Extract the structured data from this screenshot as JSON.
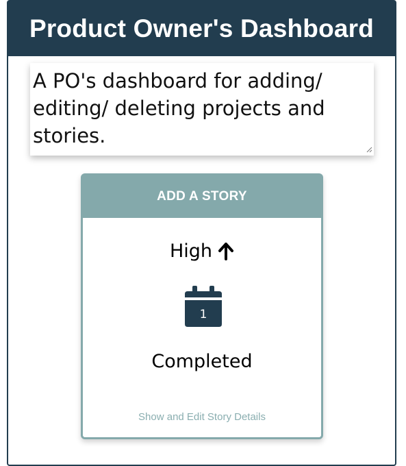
{
  "header": {
    "title": "Product Owner's Dashboard"
  },
  "description": {
    "value": "A PO's dashboard for adding/ editing/ deleting projects and stories."
  },
  "story_card": {
    "header_label": "ADD A STORY",
    "priority": "High",
    "priority_icon": "arrow-up-icon",
    "calendar_icon": "calendar-icon",
    "calendar_day": "1",
    "status": "Completed",
    "details_link": "Show and Edit Story Details"
  },
  "colors": {
    "header_bg": "#223d4f",
    "card_accent": "#84a9ab",
    "link_text": "#8aaeb0"
  }
}
